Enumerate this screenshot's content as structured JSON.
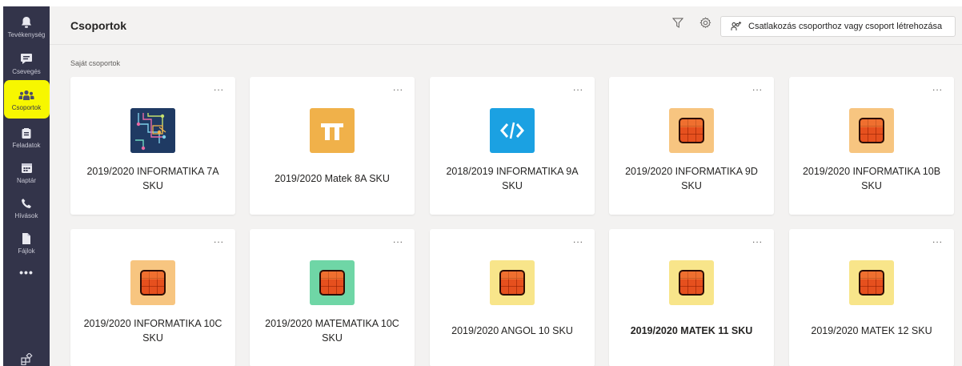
{
  "rail": {
    "items": [
      {
        "label": "Tevékenység",
        "icon": "bell-icon"
      },
      {
        "label": "Csevegés",
        "icon": "chat-icon"
      },
      {
        "label": "Csoportok",
        "icon": "teams-icon"
      },
      {
        "label": "Feladatok",
        "icon": "assignments-icon"
      },
      {
        "label": "Naptár",
        "icon": "calendar-icon"
      },
      {
        "label": "Hívások",
        "icon": "phone-icon"
      },
      {
        "label": "Fájlok",
        "icon": "files-icon"
      }
    ],
    "more": "•••",
    "active_index": 2,
    "highlight_color": "#f7f700"
  },
  "header": {
    "title": "Csoportok",
    "join_label": "Csatlakozás csoporthoz vagy csoport létrehozása"
  },
  "section_label": "Saját csoportok",
  "cards": [
    {
      "name": "2019/2020 INFORMATIKA 7A SKU",
      "avatar": "informatics-image",
      "bg": "#1f3a63",
      "more": "..."
    },
    {
      "name": "2019/2020 Matek 8A SKU",
      "avatar": "pi-icon",
      "bg": "#f0b14a",
      "more": "..."
    },
    {
      "name": "2018/2019 INFORMATIKA 9A SKU",
      "avatar": "code-icon",
      "bg": "#1ba1e2",
      "more": "..."
    },
    {
      "name": "2019/2020 INFORMATIKA 9D SKU",
      "avatar": "orange-square-icon",
      "bg": "#f7c580",
      "more": "..."
    },
    {
      "name": "2019/2020 INFORMATIKA 10B SKU",
      "avatar": "orange-square-icon",
      "bg": "#f7c580",
      "more": "..."
    },
    {
      "name": "2019/2020 INFORMATIKA 10C SKU",
      "avatar": "orange-square-icon",
      "bg": "#f7c580",
      "more": "..."
    },
    {
      "name": "2019/2020 MATEMATIKA 10C SKU",
      "avatar": "orange-square-icon",
      "bg": "#6fd6a6",
      "more": "..."
    },
    {
      "name": "2019/2020 ANGOL 10 SKU",
      "avatar": "orange-square-icon",
      "bg": "#f8e58a",
      "more": "..."
    },
    {
      "name": "2019/2020 MATEK 11 SKU",
      "avatar": "orange-square-icon",
      "bg": "#f8e58a",
      "more": "...",
      "bold": true
    },
    {
      "name": "2019/2020 MATEK 12 SKU",
      "avatar": "orange-square-icon",
      "bg": "#f8e58a",
      "more": "..."
    }
  ]
}
